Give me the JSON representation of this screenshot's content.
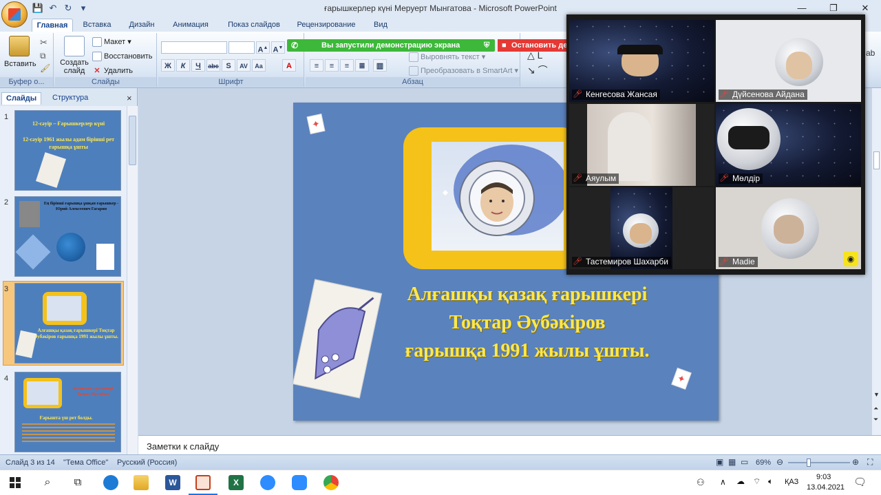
{
  "window": {
    "title": "ғарышкерлер күні Меруерт Мынгатова - Microsoft PowerPoint",
    "controls": {
      "minimize": "—",
      "maximize": "❐",
      "close": "✕"
    }
  },
  "ribbon": {
    "tabs": [
      "Главная",
      "Вставка",
      "Дизайн",
      "Анимация",
      "Показ слайдов",
      "Рецензирование",
      "Вид"
    ],
    "clipboard": {
      "paste": "Вставить",
      "label": "Буфер о..."
    },
    "slides": {
      "create": "Создать слайд",
      "layout": "Макет",
      "reset": "Восстановить",
      "delete": "Удалить",
      "label": "Слайды"
    },
    "font": {
      "label": "Шрифт"
    },
    "paragraph": {
      "align_text": "Выровнять текст",
      "smartart": "Преобразовать в SmartArt",
      "label": "Абзац"
    },
    "sharing_notice": "Вы запустили демонстрацию экрана",
    "stop_sharing": "Остановить дем"
  },
  "left_panel": {
    "tabs": [
      "Слайды",
      "Структура"
    ],
    "close": "×",
    "thumbnails": [
      {
        "num": "1",
        "title": "12-сәуір – Ғарышкерлер күні",
        "body": "12-сәуір 1961 жылы адам бірінші рет ғарышқа ұшты"
      },
      {
        "num": "2",
        "title": "Ең бірінші ғарышқа ұшқан ғарышкер - Юрий Алексеевич Гагарин"
      },
      {
        "num": "3",
        "body": "Алғашқы қазақ ғарышкері Тоқтар Әубәкіров ғарышқа 1991 жылы ұшты."
      },
      {
        "num": "4",
        "title": "Қазақтың ғарышкері Талғат Мұсабаев",
        "body": "Ғарышта үш рет болды."
      }
    ]
  },
  "slide": {
    "title_lines": [
      "Алғашқы қазақ  ғарышкері",
      "Тоқтар Әубәкіров",
      "ғарышқа 1991 жылы ұшты."
    ]
  },
  "notes_placeholder": "Заметки к слайду",
  "status": {
    "slide_of": "Слайд 3 из 14",
    "theme": "\"Тема Office\"",
    "language": "Русский (Россия)",
    "zoom": "69%"
  },
  "meeting": {
    "participants": [
      "Кенгесова Жансая",
      "Дүйсенова Айдана",
      "Аяулым",
      "Мөлдір",
      "Тастемиров Шахарби",
      "Madie"
    ]
  },
  "taskbar": {
    "language": "ҚАЗ",
    "time": "9:03",
    "date": "13.04.2021"
  },
  "colors": {
    "slide_bg": "#5a82bd",
    "slide_text": "#ffe84a",
    "frame": "#f5c21a",
    "share_green": "#3db83a",
    "stop_red": "#e53935"
  }
}
